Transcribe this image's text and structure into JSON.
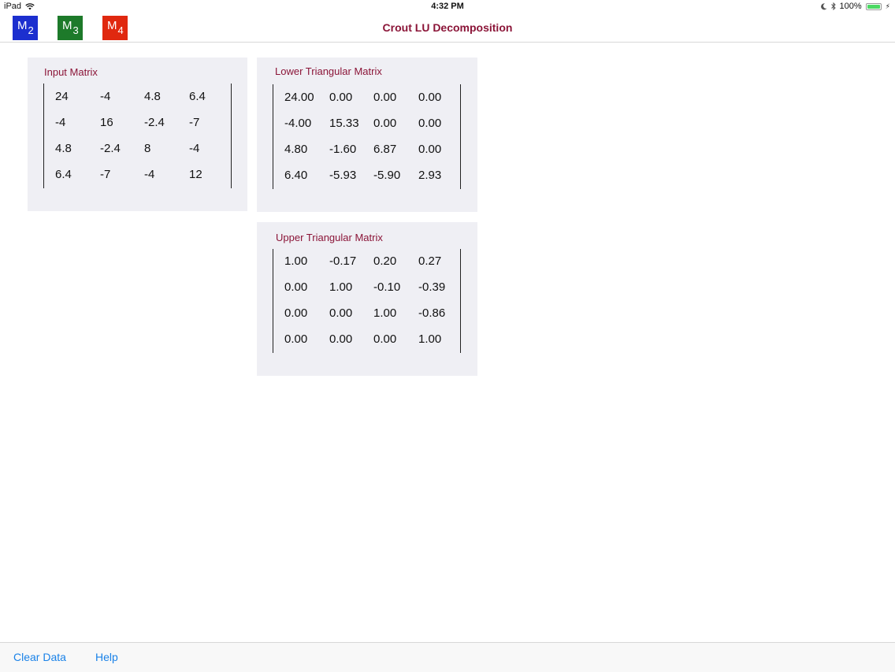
{
  "status_bar": {
    "device": "iPad",
    "time": "4:32 PM",
    "battery": "100%",
    "icons": [
      "wifi-icon",
      "moon-icon",
      "bluetooth-icon",
      "battery-icon"
    ]
  },
  "nav": {
    "title": "Crout LU Decomposition",
    "buttons": [
      {
        "letter": "M",
        "sub": "2",
        "color": "#1c2fcf"
      },
      {
        "letter": "M",
        "sub": "3",
        "color": "#1d7a2a"
      },
      {
        "letter": "M",
        "sub": "4",
        "color": "#e0280f"
      }
    ]
  },
  "input_matrix": {
    "title": "Input Matrix",
    "rows": [
      [
        "24",
        "-4",
        "4.8",
        "6.4"
      ],
      [
        "-4",
        "16",
        "-2.4",
        "-7"
      ],
      [
        "4.8",
        "-2.4",
        "8",
        "-4"
      ],
      [
        "6.4",
        "-7",
        "-4",
        "12"
      ]
    ]
  },
  "lower_matrix": {
    "title": "Lower Triangular Matrix",
    "rows": [
      [
        "24.00",
        "0.00",
        "0.00",
        "0.00"
      ],
      [
        "-4.00",
        "15.33",
        "0.00",
        "0.00"
      ],
      [
        "4.80",
        "-1.60",
        "6.87",
        "0.00"
      ],
      [
        "6.40",
        "-5.93",
        "-5.90",
        "2.93"
      ]
    ]
  },
  "upper_matrix": {
    "title": "Upper Triangular Matrix",
    "rows": [
      [
        "1.00",
        "-0.17",
        "0.20",
        "0.27"
      ],
      [
        "0.00",
        "1.00",
        "-0.10",
        "-0.39"
      ],
      [
        "0.00",
        "0.00",
        "1.00",
        "-0.86"
      ],
      [
        "0.00",
        "0.00",
        "0.00",
        "1.00"
      ]
    ]
  },
  "toolbar": {
    "clear_label": "Clear Data",
    "help_label": "Help"
  }
}
